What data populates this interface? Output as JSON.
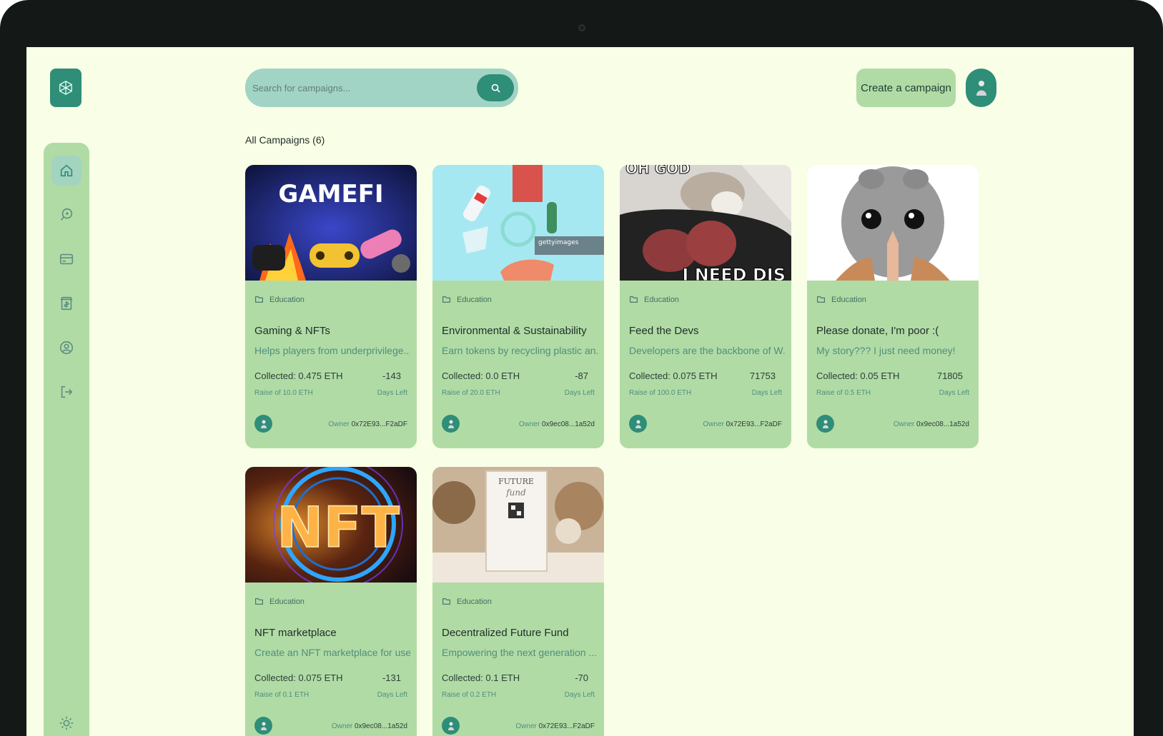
{
  "header": {
    "search_placeholder": "Search for campaigns...",
    "create_label": "Create a campaign"
  },
  "sidebar": {
    "items": [
      {
        "icon": "home-icon",
        "active": true
      },
      {
        "icon": "campaign-icon",
        "active": false
      },
      {
        "icon": "payment-icon",
        "active": false
      },
      {
        "icon": "withdraw-icon",
        "active": false
      },
      {
        "icon": "profile-icon",
        "active": false
      },
      {
        "icon": "logout-icon",
        "active": false
      }
    ],
    "theme_icon": "sun-icon"
  },
  "main": {
    "section_title": "All Campaigns (6)",
    "cards": [
      {
        "category": "Education",
        "title": "Gaming & NFTs",
        "description": "Helps players from underprivilege...",
        "collected": "Collected: 0.475 ETH",
        "days": "-143",
        "raise": "Raise of 10.0 ETH",
        "days_label": "Days Left",
        "owner_label": "Owner",
        "owner": "0x72E93...F2aDF"
      },
      {
        "category": "Education",
        "title": "Environmental & Sustainability",
        "description": "Earn tokens by recycling plastic an...",
        "collected": "Collected: 0.0 ETH",
        "days": "-87",
        "raise": "Raise of 20.0 ETH",
        "days_label": "Days Left",
        "owner_label": "Owner",
        "owner": "0x9ec08...1a52d"
      },
      {
        "category": "Education",
        "title": "Feed the Devs",
        "description": "Developers are the backbone of W...",
        "collected": "Collected: 0.075 ETH",
        "days": "71753",
        "raise": "Raise of 100.0 ETH",
        "days_label": "Days Left",
        "owner_label": "Owner",
        "owner": "0x72E93...F2aDF"
      },
      {
        "category": "Education",
        "title": "Please donate, I'm poor :(",
        "description": "My story??? I just need money!",
        "collected": "Collected: 0.05 ETH",
        "days": "71805",
        "raise": "Raise of 0.5 ETH",
        "days_label": "Days Left",
        "owner_label": "Owner",
        "owner": "0x9ec08...1a52d"
      },
      {
        "category": "Education",
        "title": "NFT marketplace",
        "description": "Create an NFT marketplace for use...",
        "collected": "Collected: 0.075 ETH",
        "days": "-131",
        "raise": "Raise of 0.1 ETH",
        "days_label": "Days Left",
        "owner_label": "Owner",
        "owner": "0x9ec08...1a52d"
      },
      {
        "category": "Education",
        "title": "Decentralized Future Fund",
        "description": "Empowering the next generation ...",
        "collected": "Collected: 0.1 ETH",
        "days": "-70",
        "raise": "Raise of 0.2 ETH",
        "days_label": "Days Left",
        "owner_label": "Owner",
        "owner": "0x72E93...F2aDF"
      }
    ],
    "images": {
      "gamefi_text": "GAMEFI",
      "getty_text": "gettyimages",
      "meme_top": "OH GOD",
      "meme_bottom": "I NEED DIS",
      "nft_text": "NFT",
      "future_text": "FUTURE",
      "future_sub": "fund"
    }
  },
  "colors": {
    "accent": "#2e8e78",
    "card_bg": "#b1dba5",
    "page_bg": "#f9ffe6"
  }
}
